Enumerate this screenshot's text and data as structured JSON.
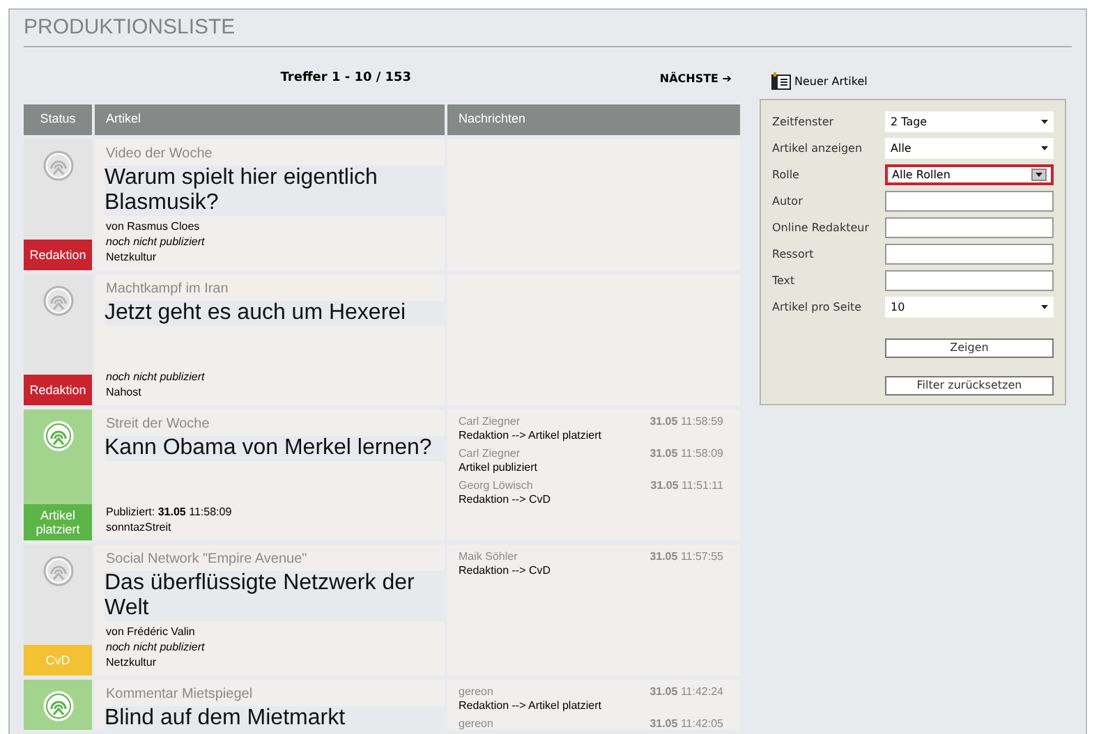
{
  "page_title": "PRODUKTIONSLISTE",
  "pager": {
    "summary": "Treffer 1 - 10 / 153",
    "next": "NÄCHSTE ➔"
  },
  "new_article": "Neuer Artikel",
  "table": {
    "columns": [
      "Status",
      "Artikel",
      "Nachrichten"
    ],
    "rows": [
      {
        "status": {
          "label": "Redaktion",
          "color": "#c8232f",
          "placed": false
        },
        "kicker": "Video der Woche",
        "title": "Warum spielt hier eigentlich Blasmusik?",
        "byline": "von Rasmus Cloes",
        "publication": "noch nicht publiziert",
        "published": false,
        "ressort": "Netzkultur",
        "messages": []
      },
      {
        "status": {
          "label": "Redaktion",
          "color": "#c8232f",
          "placed": false
        },
        "kicker": "Machtkampf im Iran",
        "title": "Jetzt geht es auch um Hexerei",
        "publication": "noch nicht publiziert",
        "published": false,
        "ressort": "Nahost",
        "messages": []
      },
      {
        "status": {
          "label": "Artikel platziert",
          "color": "#5db548",
          "placed": true
        },
        "kicker": "Streit der Woche",
        "title": "Kann Obama von Merkel lernen?",
        "publication": "Publiziert: **31.05** 11:58:09",
        "published": true,
        "ressort": "sonntazStreit",
        "messages": [
          {
            "author": "Carl Ziegner",
            "date": "31.05",
            "time": "11:58:59",
            "action": "Redaktion --> Artikel platziert"
          },
          {
            "author": "Carl Ziegner",
            "date": "31.05",
            "time": "11:58:09",
            "action": "Artikel publiziert"
          },
          {
            "author": "Georg Löwisch",
            "date": "31.05",
            "time": "11:51:11",
            "action": "Redaktion --> CvD"
          }
        ]
      },
      {
        "status": {
          "label": "CvD",
          "color": "#f2c232",
          "placed": false
        },
        "kicker": "Social Network \"Empire Avenue\"",
        "title": "Das überflüssigte Netzwerk der Welt",
        "byline": "von Frédéric Valin",
        "publication": "noch nicht publiziert",
        "published": false,
        "ressort": "Netzkultur",
        "messages": [
          {
            "author": "Maik Söhler",
            "date": "31.05",
            "time": "11:57:55",
            "action": "Redaktion --> CvD"
          }
        ]
      },
      {
        "status": {
          "placed": true
        },
        "kicker": "Kommentar Mietspiegel",
        "title": "Blind auf dem Mietmarkt",
        "messages": [
          {
            "author": "gereon",
            "date": "31.05",
            "time": "11:42:24",
            "action": "Redaktion --> Artikel platziert"
          },
          {
            "author": "gereon",
            "date": "31.05",
            "time": "11:42:05"
          }
        ]
      }
    ]
  },
  "filter": {
    "fields": [
      {
        "label": "Zeitfenster",
        "kind": "select",
        "value": "2 Tage",
        "highlighted": false
      },
      {
        "label": "Artikel anzeigen",
        "kind": "select",
        "value": "Alle",
        "highlighted": false
      },
      {
        "label": "Rolle",
        "kind": "select",
        "value": "Alle Rollen",
        "highlighted": true
      },
      {
        "label": "Autor",
        "kind": "text",
        "highlighted": false
      },
      {
        "label": "Online Redakteur",
        "kind": "text",
        "highlighted": false
      },
      {
        "label": "Ressort",
        "kind": "text",
        "highlighted": false
      },
      {
        "label": "Text",
        "kind": "text",
        "highlighted": false
      },
      {
        "label": "Artikel pro Seite",
        "kind": "select",
        "value": "10",
        "highlighted": false
      }
    ],
    "buttons": [
      "Zeigen",
      "Filter zurücksetzen"
    ]
  }
}
